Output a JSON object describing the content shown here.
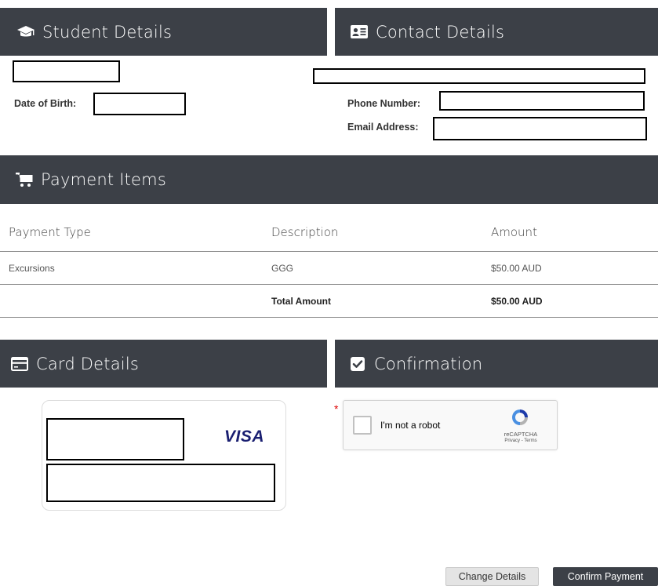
{
  "student": {
    "title": "Student Details",
    "dob_label": "Date of Birth:"
  },
  "contact": {
    "title": "Contact Details",
    "phone_label": "Phone Number:",
    "email_label": "Email Address:"
  },
  "payment": {
    "title": "Payment Items",
    "columns": [
      "Payment Type",
      "Description",
      "Amount"
    ],
    "rows": [
      {
        "type": "Excursions",
        "description": "GGG",
        "amount": "$50.00 AUD"
      }
    ],
    "total_label": "Total Amount",
    "total_amount": "$50.00 AUD"
  },
  "card": {
    "title": "Card Details",
    "brand": "VISA"
  },
  "confirmation": {
    "title": "Confirmation",
    "required_mark": "*",
    "captcha_label": "I'm not a robot",
    "captcha_brand": "reCAPTCHA",
    "captcha_terms": "Privacy - Terms"
  },
  "actions": {
    "change_label": "Change Details",
    "confirm_label": "Confirm Payment"
  },
  "colors": {
    "header_bg": "#3c4047",
    "visa_blue": "#1a1f71",
    "required": "#dd0000"
  },
  "icons": {
    "student": "graduation-cap-icon",
    "contact": "id-card-icon",
    "payment": "shopping-cart-icon",
    "card": "credit-card-icon",
    "confirmation": "check-square-icon"
  }
}
